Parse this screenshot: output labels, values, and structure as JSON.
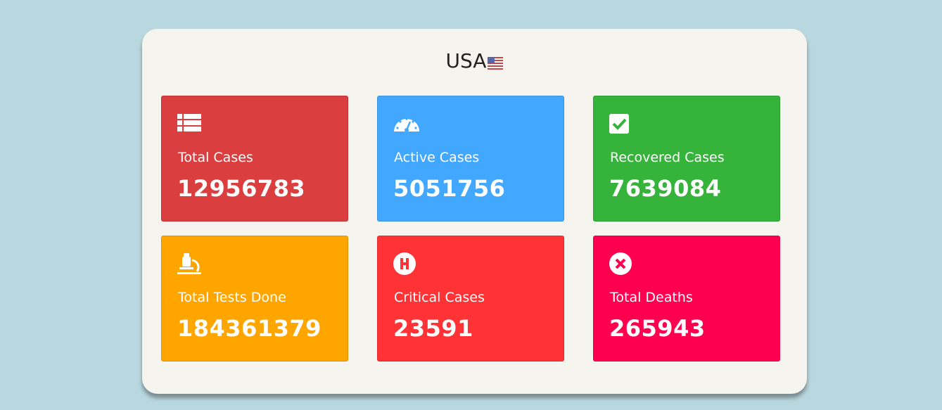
{
  "header": {
    "country": "USA",
    "flag_icon": "us-flag-icon"
  },
  "cards": [
    {
      "label": "Total Cases",
      "value": "12956783",
      "icon": "table-icon",
      "color": "#da3e3f"
    },
    {
      "label": "Active Cases",
      "value": "5051756",
      "icon": "speedometer-icon",
      "color": "#42a7ff"
    },
    {
      "label": "Recovered Cases",
      "value": "7639084",
      "icon": "check-square-icon",
      "color": "#35b33a"
    },
    {
      "label": "Total Tests Done",
      "value": "184361379",
      "icon": "microscope-icon",
      "color": "#ffa500"
    },
    {
      "label": "Critical Cases",
      "value": "23591",
      "icon": "hospital-icon",
      "color": "#ff3336"
    },
    {
      "label": "Total Deaths",
      "value": "265943",
      "icon": "times-circle-icon",
      "color": "#ff0050"
    }
  ]
}
